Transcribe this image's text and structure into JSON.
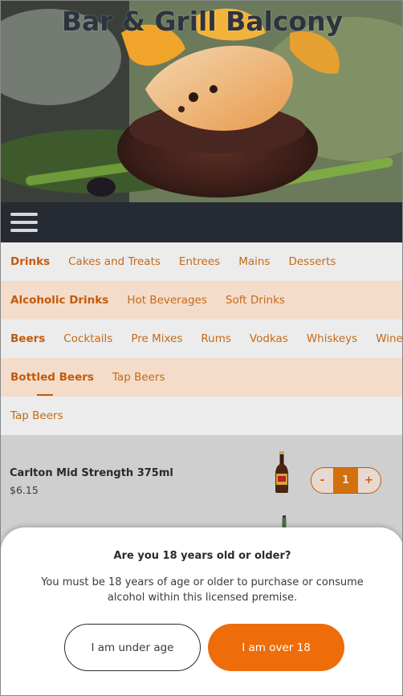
{
  "header": {
    "title": "Bar & Grill Balcony",
    "hero_image": "steak-and-grilled-prawn-photo"
  },
  "navbar": {
    "menu_icon": "hamburger-menu-icon"
  },
  "categories": {
    "level1": [
      "Drinks",
      "Cakes and Treats",
      "Entrees",
      "Mains",
      "Desserts"
    ],
    "level2": [
      "Alcoholic Drinks",
      "Hot Beverages",
      "Soft Drinks"
    ],
    "level3": [
      "Beers",
      "Cocktails",
      "Pre Mixes",
      "Rums",
      "Vodkas",
      "Whiskeys",
      "Wines"
    ],
    "level4": [
      "Bottled Beers",
      "Tap Beers"
    ],
    "level5": [
      "Tap Beers"
    ]
  },
  "products": [
    {
      "name": "Carlton Mid Strength 375ml",
      "price": "$6.15",
      "quantity": "1",
      "decrement": "-",
      "increment": "+",
      "image": "beer-bottle-icon"
    }
  ],
  "age_modal": {
    "title": "Are you 18 years old or older?",
    "message": "You must be 18 years of age or older to purchase or consume alcohol within this licensed premise.",
    "under_label": "I am under age",
    "over_label": "I am over 18"
  },
  "colors": {
    "accent": "#c35a0a",
    "button_primary": "#ee6d0a",
    "navbar": "#262b33",
    "band_alt": "#f4dccb"
  }
}
